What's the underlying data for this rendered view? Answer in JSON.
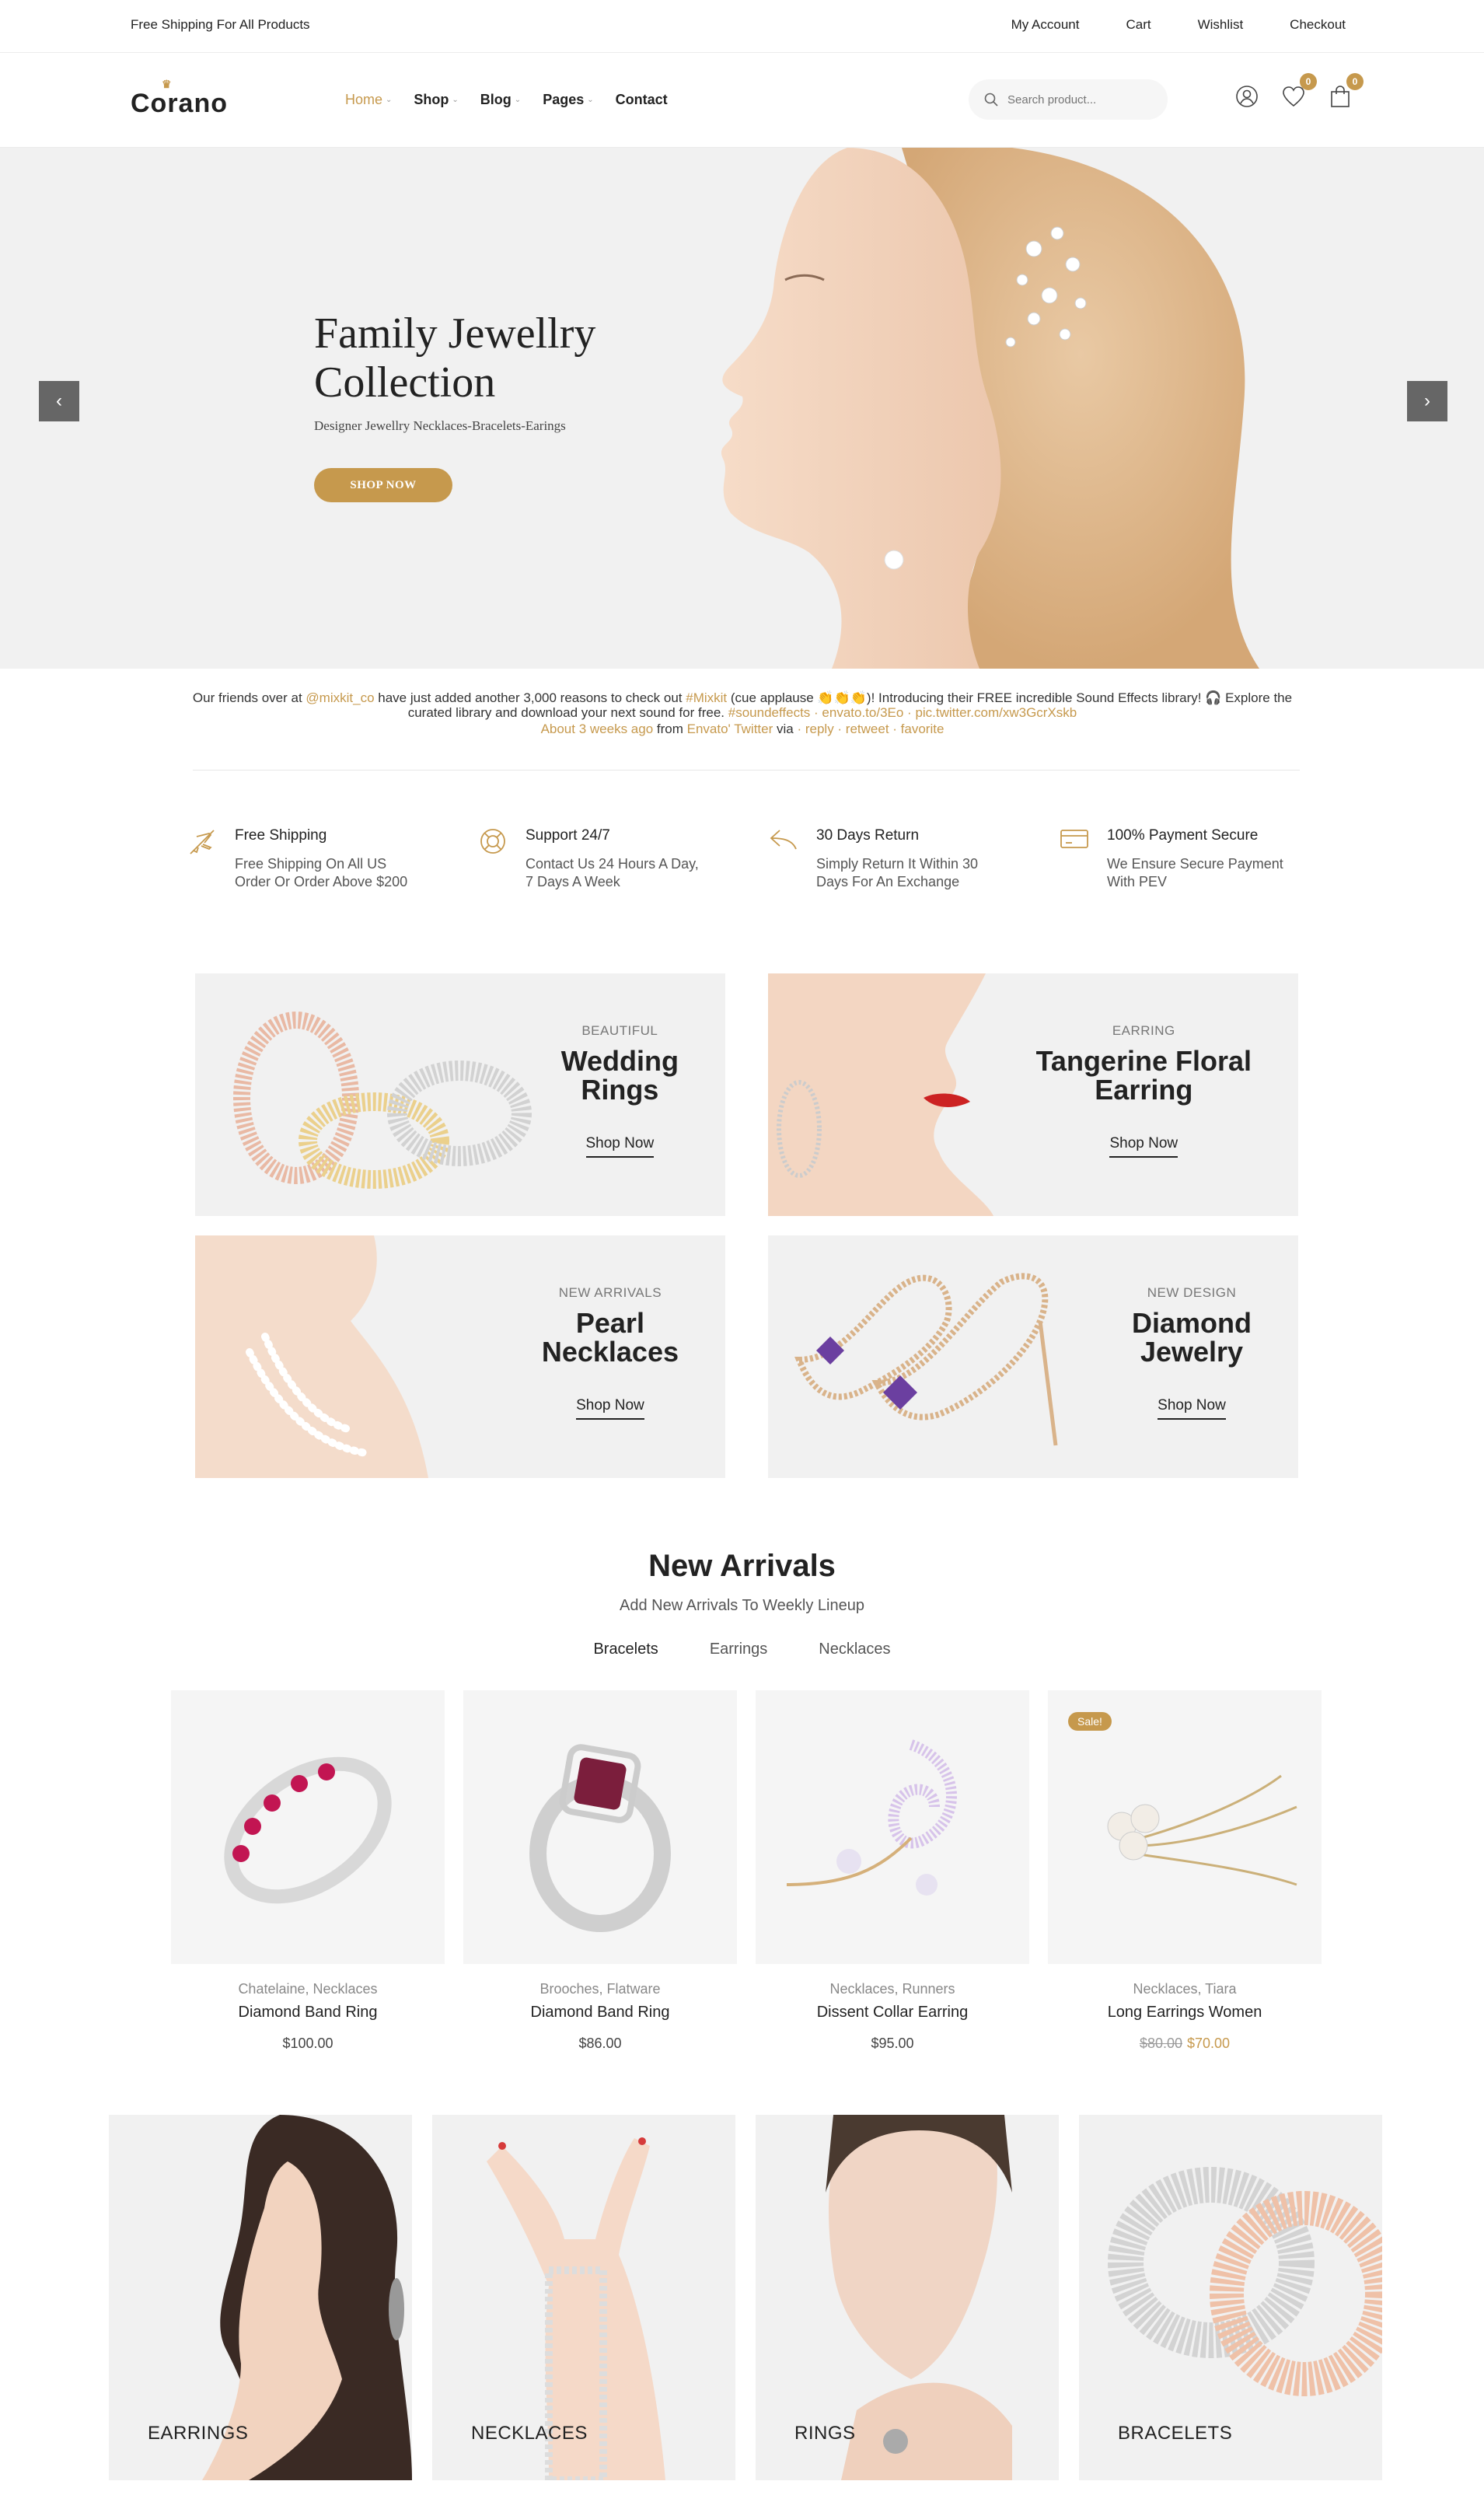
{
  "topbar": {
    "shipping": "Free Shipping For All Products",
    "links": [
      "My Account",
      "Cart",
      "Wishlist",
      "Checkout"
    ]
  },
  "header": {
    "logo": "Corano",
    "nav": [
      {
        "label": "Home",
        "active": true,
        "dropdown": true
      },
      {
        "label": "Shop",
        "active": false,
        "dropdown": true
      },
      {
        "label": "Blog",
        "active": false,
        "dropdown": true
      },
      {
        "label": "Pages",
        "active": false,
        "dropdown": true
      },
      {
        "label": "Contact",
        "active": false,
        "dropdown": false
      }
    ],
    "search_placeholder": "Search product...",
    "wishlist_count": "0",
    "cart_count": "0"
  },
  "hero": {
    "title_line1": "Family Jewellry",
    "title_line2": "Collection",
    "subtitle": "Designer Jewellry Necklaces-Bracelets-Earings",
    "button": "SHOP NOW",
    "prev": "‹",
    "next": "›"
  },
  "tweet": {
    "t1": "Our friends over at ",
    "h1": "@mixkit_co",
    "t2": " have just added another 3,000 reasons to check out ",
    "h2": "#Mixkit",
    "t3": " (cue applause 👏👏👏)! Introducing their FREE incredible Sound Effects library! 🎧 Explore the curated library and download your next sound for free. ",
    "h3": "#soundeffects",
    "sep1": " · ",
    "h4": "envato.to/3Eo",
    "sep2": " · ",
    "h5": "pic.twitter.com/xw3GcrXskb",
    "m1": "About 3 weeks ago",
    "m2": " from ",
    "m3": "Envato' Twitter",
    "m4": " via",
    "m5": " · reply · retweet · favorite"
  },
  "features": [
    {
      "title": "Free Shipping",
      "line1": "Free Shipping On All US",
      "line2": "Order Or Order Above $200",
      "icon": "plane-icon"
    },
    {
      "title": "Support 24/7",
      "line1": "Contact Us 24 Hours A Day,",
      "line2": "7 Days A Week",
      "icon": "lifebuoy-icon"
    },
    {
      "title": "30 Days Return",
      "line1": "Simply Return It Within 30",
      "line2": "Days For An Exchange",
      "icon": "return-icon"
    },
    {
      "title": "100% Payment Secure",
      "line1": "We Ensure Secure Payment",
      "line2": "With PEV",
      "icon": "credit-card-icon"
    }
  ],
  "banners": [
    {
      "category": "BEAUTIFUL",
      "title1": "Wedding",
      "title2": "Rings",
      "link": "Shop Now"
    },
    {
      "category": "EARRING",
      "title1": "Tangerine Floral",
      "title2": "Earring",
      "link": "Shop Now"
    },
    {
      "category": "NEW ARRIVALS",
      "title1": "Pearl",
      "title2": "Necklaces",
      "link": "Shop Now"
    },
    {
      "category": "NEW DESIGN",
      "title1": "Diamond",
      "title2": "Jewelry",
      "link": "Shop Now"
    }
  ],
  "new_arrivals": {
    "title": "New Arrivals",
    "subtitle": "Add New Arrivals To Weekly Lineup",
    "tabs": [
      "Bracelets",
      "Earrings",
      "Necklaces"
    ],
    "active_tab": "Bracelets",
    "products": [
      {
        "categories": "Chatelaine, Necklaces",
        "name": "Diamond Band Ring",
        "price": "$100.00"
      },
      {
        "categories": "Brooches, Flatware",
        "name": "Diamond Band Ring",
        "price": "$86.00"
      },
      {
        "categories": "Necklaces, Runners",
        "name": "Dissent Collar Earring",
        "price": "$95.00"
      },
      {
        "categories": "Necklaces, Tiara",
        "name": "Long Earrings Women",
        "old_price": "$80.00",
        "price": "$70.00",
        "badge": "Sale!"
      }
    ]
  },
  "categories": [
    "EARRINGS",
    "NECKLACES",
    "RINGS",
    "BRACELETS"
  ],
  "colors": {
    "accent": "#c6994d",
    "text": "#222222",
    "panel": "#f1f1f1"
  }
}
